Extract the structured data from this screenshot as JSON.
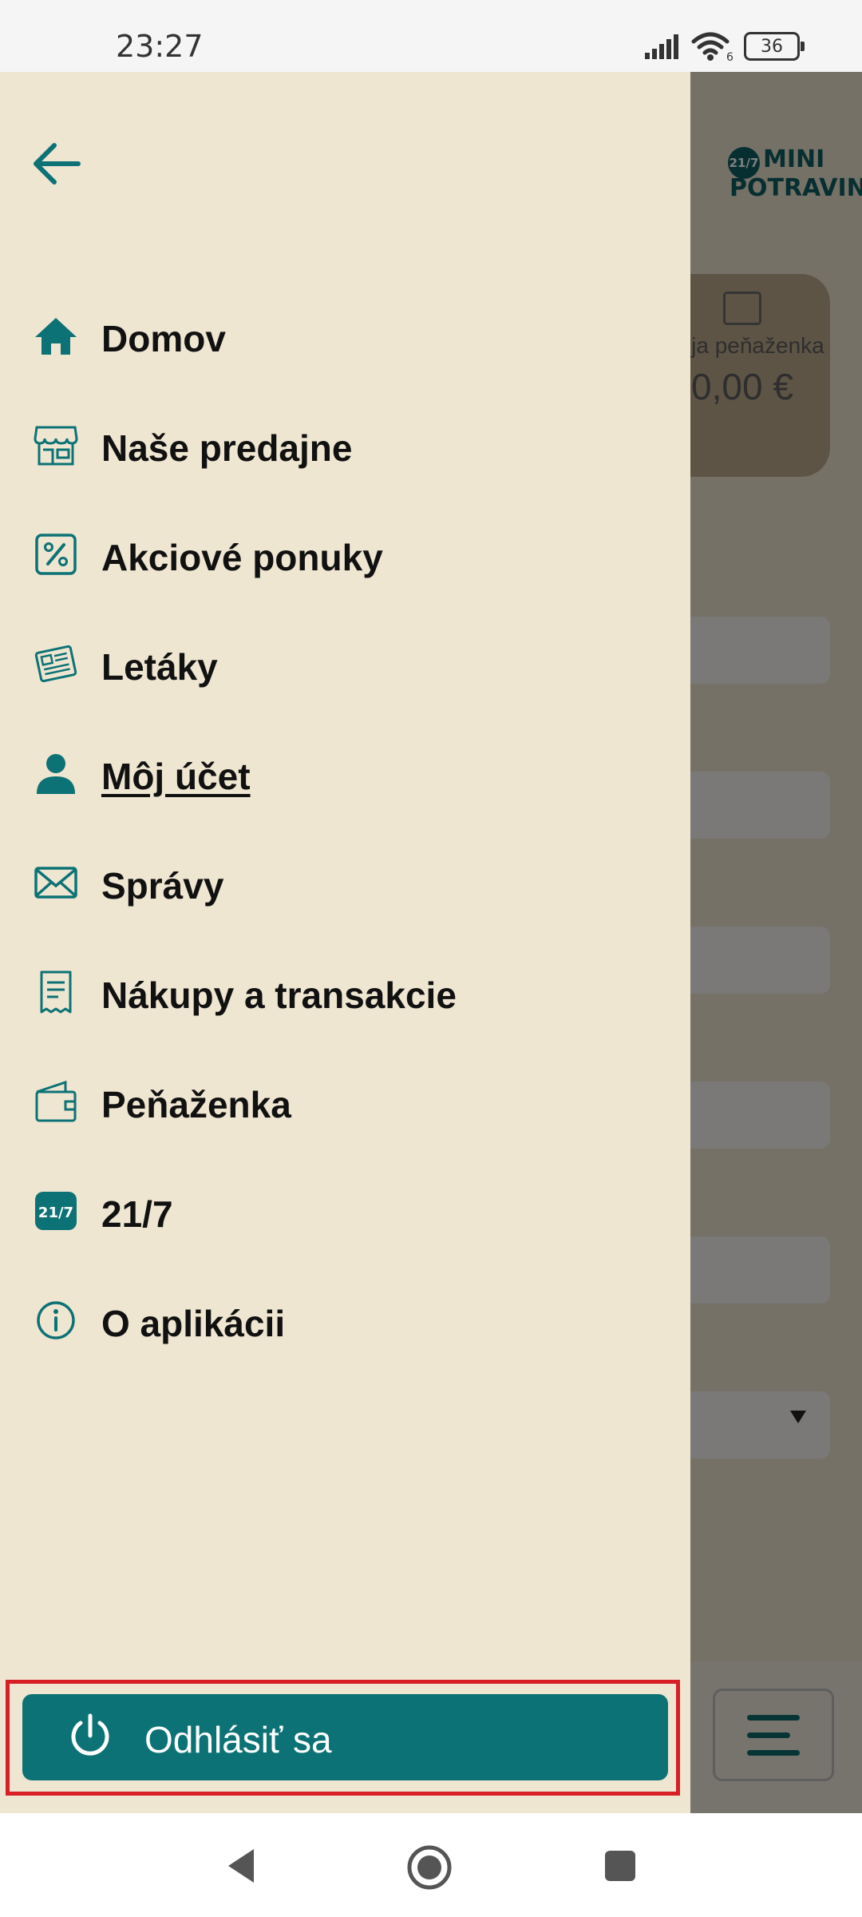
{
  "status_bar": {
    "time": "23:27",
    "battery": "36",
    "wifi_badge": "6"
  },
  "background": {
    "logo_badge": "21/7",
    "logo_line1": "MINI",
    "logo_line2": "POTRAVINY",
    "wallet_label": "Moja peňaženka",
    "wallet_amount": "0,00 €"
  },
  "drawer": {
    "back_icon": "arrow-left-icon",
    "items": [
      {
        "label": "Domov",
        "icon": "home-icon"
      },
      {
        "label": "Naše predajne",
        "icon": "store-icon"
      },
      {
        "label": "Akciové ponuky",
        "icon": "percent-icon"
      },
      {
        "label": "Letáky",
        "icon": "newspaper-icon"
      },
      {
        "label": "Môj účet",
        "icon": "person-icon",
        "active": true
      },
      {
        "label": "Správy",
        "icon": "envelope-icon"
      },
      {
        "label": "Nákupy a transakcie",
        "icon": "receipt-icon"
      },
      {
        "label": "Peňaženka",
        "icon": "wallet-icon"
      },
      {
        "label": "21/7",
        "icon": "badge-21-7-icon",
        "badge_text": "21/7"
      },
      {
        "label": "O aplikácii",
        "icon": "info-icon"
      }
    ],
    "logout_label": "Odhlásiť sa"
  },
  "colors": {
    "accent": "#0c7275",
    "drawer_bg": "#efe6d2",
    "highlight": "#d81f26"
  }
}
